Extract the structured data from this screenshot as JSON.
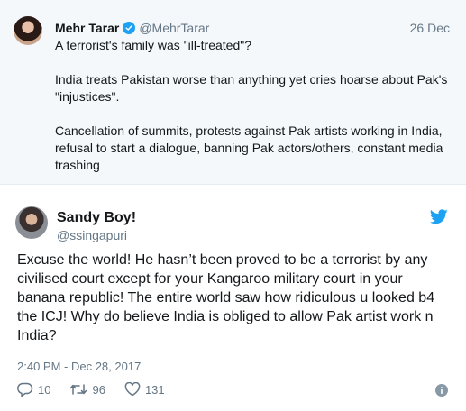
{
  "quoted_tweet": {
    "author_name": "Mehr Tarar",
    "handle": "@MehrTarar",
    "date": "26 Dec",
    "paragraphs": [
      "A terrorist's family was \"ill-treated\"?",
      "India treats Pakistan worse than anything yet cries hoarse about Pak's \"injustices\".",
      "Cancellation of summits, protests against Pak artists working in India, refusal to start a dialogue, banning Pak actors/others, constant media trashing"
    ]
  },
  "tweet": {
    "author_name": "Sandy Boy!",
    "handle": "@ssingapuri",
    "text": "Excuse the world! He hasn’t been proved to be a terrorist by any civilised court except for your Kangaroo military court in your banana republic! The entire world saw how ridiculous u looked b4 the ICJ! Why do believe India is obliged to allow Pak artist work n India?",
    "timestamp": "2:40 PM - Dec 28, 2017",
    "replies": "10",
    "retweets": "96",
    "likes": "131"
  },
  "colors": {
    "brand": "#1da1f2",
    "secondary_text": "#657786",
    "quoted_bg": "#f5f8fa"
  },
  "icons": [
    "verified-badge-icon",
    "twitter-bird-icon",
    "reply-icon",
    "retweet-icon",
    "like-icon",
    "info-icon"
  ]
}
